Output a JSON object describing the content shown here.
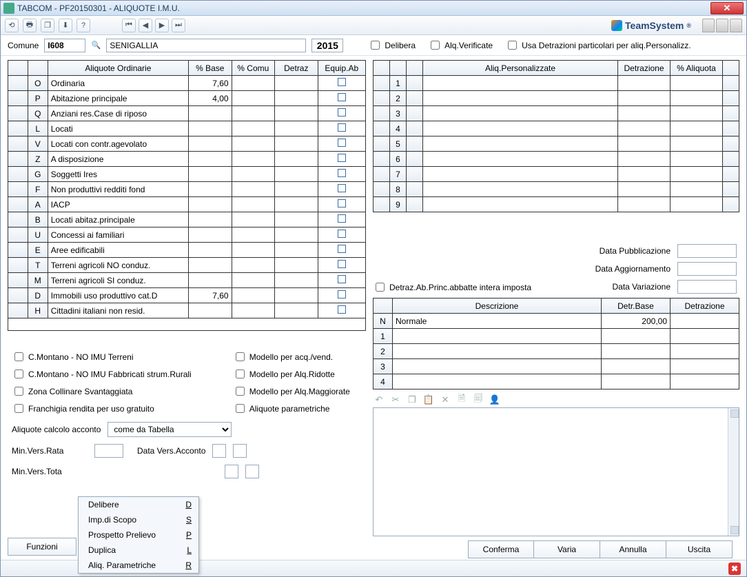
{
  "title": "TABCOM  -  PF20150301  -   ALIQUOTE I.M.U.",
  "brand": "TeamSystem",
  "header": {
    "comune_label": "Comune",
    "comune_code": "I608",
    "comune_name": "SENIGALLIA",
    "year": "2015",
    "chk_delibera": "Delibera",
    "chk_alq_verificate": "Alq.Verificate",
    "chk_usa_detraz": "Usa Detrazioni particolari per aliq.Personalizz."
  },
  "left_table": {
    "headers": [
      "",
      "",
      "Aliquote Ordinarie",
      "% Base",
      "% Comu",
      "Detraz",
      "Equip.Ab"
    ],
    "rows": [
      {
        "code": "O",
        "desc": "Ordinaria",
        "base": "7,60"
      },
      {
        "code": "P",
        "desc": "Abitazione principale",
        "base": "4,00"
      },
      {
        "code": "Q",
        "desc": "Anziani res.Case di riposo",
        "base": ""
      },
      {
        "code": "L",
        "desc": "Locati",
        "base": ""
      },
      {
        "code": "V",
        "desc": "Locati con contr.agevolato",
        "base": ""
      },
      {
        "code": "Z",
        "desc": "A disposizione",
        "base": ""
      },
      {
        "code": "G",
        "desc": "Soggetti Ires",
        "base": ""
      },
      {
        "code": "F",
        "desc": "Non produttivi redditi fond",
        "base": ""
      },
      {
        "code": "A",
        "desc": "IACP",
        "base": ""
      },
      {
        "code": "B",
        "desc": "Locati abitaz.principale",
        "base": ""
      },
      {
        "code": "U",
        "desc": "Concessi ai familiari",
        "base": ""
      },
      {
        "code": "E",
        "desc": "Aree edificabili",
        "base": ""
      },
      {
        "code": "T",
        "desc": "Terreni agricoli NO conduz.",
        "base": ""
      },
      {
        "code": "M",
        "desc": "Terreni agricoli SI conduz.",
        "base": ""
      },
      {
        "code": "D",
        "desc": "Immobili uso produttivo cat.D",
        "base": "7,60"
      },
      {
        "code": "H",
        "desc": "Cittadini italiani non resid.",
        "base": ""
      }
    ]
  },
  "right_table": {
    "headers": [
      "",
      "",
      "",
      "Aliq.Personalizzate",
      "Detrazione",
      "% Aliquota",
      ""
    ],
    "rows": [
      "1",
      "2",
      "3",
      "4",
      "5",
      "6",
      "7",
      "8",
      "9"
    ]
  },
  "dates": {
    "pub": "Data Pubblicazione",
    "agg": "Data Aggiornamento",
    "var": "Data Variazione"
  },
  "detraz_chk": "Detraz.Ab.Princ.abbatte intera imposta",
  "detraz_table": {
    "headers": [
      "",
      "Descrizione",
      "Detr.Base",
      "Detrazione"
    ],
    "rows": [
      {
        "n": "N",
        "desc": "Normale",
        "base": "200,00",
        "det": ""
      },
      {
        "n": "1",
        "desc": "",
        "base": "",
        "det": ""
      },
      {
        "n": "2",
        "desc": "",
        "base": "",
        "det": ""
      },
      {
        "n": "3",
        "desc": "",
        "base": "",
        "det": ""
      },
      {
        "n": "4",
        "desc": "",
        "base": "",
        "det": ""
      }
    ]
  },
  "options_left": [
    "C.Montano - NO IMU Terreni",
    "C.Montano - NO IMU Fabbricati strum.Rurali",
    "Zona Collinare Svantaggiata",
    "Franchigia rendita per uso gratuito"
  ],
  "options_right": [
    "Modello per acq./vend.",
    "Modello per Alq.Ridotte",
    "Modello per Alq.Maggiorate",
    "Aliquote parametriche"
  ],
  "acconto": {
    "label": "Aliquote calcolo acconto",
    "value": "come da Tabella",
    "min_rata": "Min.Vers.Rata",
    "min_totale": "Min.Vers.Tota",
    "data_acconto": "Data Vers.Acconto"
  },
  "buttons": {
    "funzioni": "Funzioni",
    "conferma": "Conferma",
    "varia": "Varia",
    "annulla": "Annulla",
    "uscita": "Uscita"
  },
  "menu": [
    {
      "label": "Delibere",
      "key": "D"
    },
    {
      "label": "Imp.di Scopo",
      "key": "S"
    },
    {
      "label": "Prospetto Prelievo",
      "key": "P"
    },
    {
      "label": "Duplica",
      "key": "L"
    },
    {
      "label": "Aliq. Parametriche",
      "key": "R"
    }
  ]
}
